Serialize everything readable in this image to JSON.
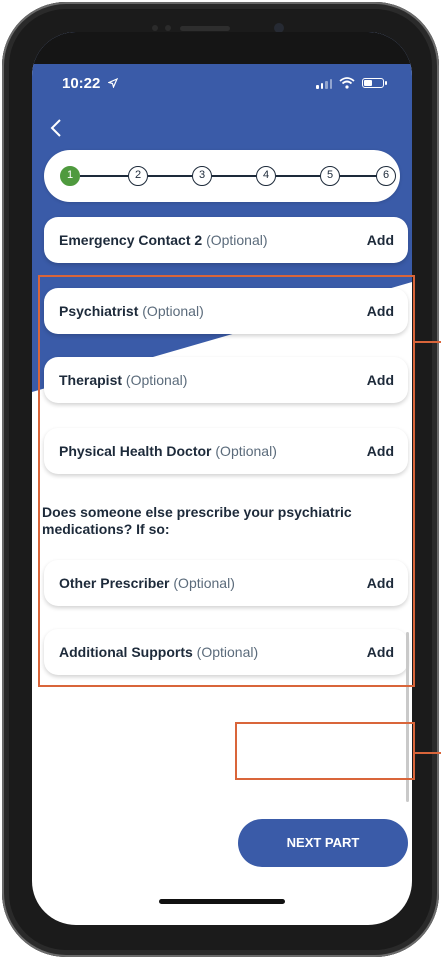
{
  "status_bar": {
    "time": "10:22"
  },
  "stepper": {
    "steps": [
      "1",
      "2",
      "3",
      "4",
      "5",
      "6"
    ],
    "active_index": 0
  },
  "contacts": [
    {
      "title": "Emergency Contact 2",
      "optional": "(Optional)",
      "action": "Add"
    },
    {
      "title": "Psychiatrist",
      "optional": "(Optional)",
      "action": "Add"
    },
    {
      "title": "Therapist",
      "optional": "(Optional)",
      "action": "Add"
    },
    {
      "title": "Physical Health Doctor",
      "optional": "(Optional)",
      "action": "Add"
    },
    {
      "title": "Other Prescriber",
      "optional": "(Optional)",
      "action": "Add"
    },
    {
      "title": "Additional Supports",
      "optional": "(Optional)",
      "action": "Add"
    }
  ],
  "question": "Does someone else prescribe your psychiatric medications? If so:",
  "next_button": {
    "label": "NEXT PART"
  },
  "colors": {
    "brand_blue": "#3a5ba8",
    "active_step_green": "#4f9a3e",
    "annotation_orange": "#d9653a",
    "text_navy": "#1d2a3a"
  },
  "icons": {
    "back": "chevron-left-icon",
    "location": "location-arrow-icon",
    "signal": "signal-icon",
    "wifi": "wifi-icon",
    "battery": "battery-icon"
  }
}
